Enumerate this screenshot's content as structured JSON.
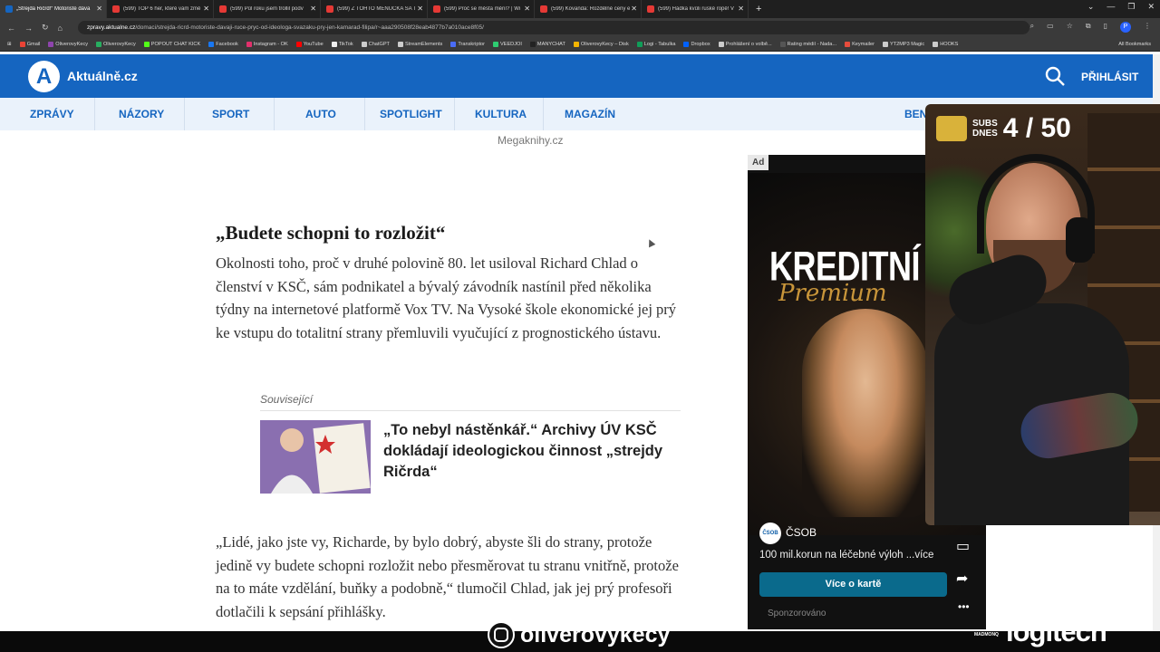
{
  "browser": {
    "tabs": [
      {
        "title": "„Strejda Ričrd!“ Motoristé dáva",
        "color": "#1565c0"
      },
      {
        "title": "(599) TOP 6 her, které vám změ",
        "color": "#e53935"
      },
      {
        "title": "(599) Půl roku jsem trollil podv",
        "color": "#e53935"
      },
      {
        "title": "(599) Z TOHTO MENUČKA SA T",
        "color": "#e53935"
      },
      {
        "title": "(599) Proč se města mění? | Wi",
        "color": "#e53935"
      },
      {
        "title": "(599) Kovanda: Rozdělné ceny e",
        "color": "#e53935"
      },
      {
        "title": "(599) Hádka kvůli ruské ropě! V",
        "color": "#e53935"
      }
    ],
    "new_tab": "+",
    "url_domain": "zpravy.aktualne.cz",
    "url_path": "/domaci/strejda-ricrd-motoriste-davaji-ruce-pryc-od-ideologa-svazaku-pry-jen-kamarad-filipa/r~aaa290508f28eab4877b7a010ace8f05/",
    "profile_initial": "P",
    "bookmarks": [
      {
        "label": "Gmail",
        "color": "#ea4335"
      },
      {
        "label": "OliverovyKecy",
        "color": "#8e44ad"
      },
      {
        "label": "OliverovyKecy",
        "color": "#27ae60"
      },
      {
        "label": "POPOUT CHAT KICK",
        "color": "#53fc18"
      },
      {
        "label": "Facebook",
        "color": "#1877f2"
      },
      {
        "label": "Instagram - OK",
        "color": "#e1306c"
      },
      {
        "label": "YouTube",
        "color": "#ff0000"
      },
      {
        "label": "TikTok",
        "color": "#eeeeee"
      },
      {
        "label": "ChatGPT",
        "color": "#cccccc"
      },
      {
        "label": "StreamElements",
        "color": "#cccccc"
      },
      {
        "label": "Transkriptor",
        "color": "#4a6cf7"
      },
      {
        "label": "VEEDJOI",
        "color": "#2ecc71"
      },
      {
        "label": "MANYCHAT",
        "color": "#222222"
      },
      {
        "label": "OliverovyKecy – Disk",
        "color": "#f4b400"
      },
      {
        "label": "Logi - Tabulka",
        "color": "#0f9d58"
      },
      {
        "label": "Dropbox",
        "color": "#0061ff"
      },
      {
        "label": "Prohlášení o volbě...",
        "color": "#cccccc"
      },
      {
        "label": "Rating médií - Nada...",
        "color": "#555555"
      },
      {
        "label": "Keymailer",
        "color": "#e74c3c"
      },
      {
        "label": "YT2MP3 Magic",
        "color": "#cccccc"
      },
      {
        "label": "HOOKS",
        "color": "#cccccc"
      }
    ],
    "all_bookmarks": "All Bookmarks"
  },
  "site": {
    "logo_letter": "A",
    "logo_text": "Aktuálně.cz",
    "login": "PŘIHLÁSIT",
    "brand_color": "#1565c0",
    "nav": [
      "ZPRÁVY",
      "NÁZORY",
      "SPORT",
      "AUTO",
      "SPOTLIGHT",
      "KULTURA",
      "MAGAZÍN",
      "BEN"
    ]
  },
  "article": {
    "image_credit": "Megaknihy.cz",
    "heading": "„Budete schopni to rozložit“",
    "paragraph1": "Okolnosti toho, proč v druhé polovině 80. let usiloval Richard Chlad o členství v KSČ, sám podnikatel a bývalý závodník nastínil před několika týdny na internetové platformě Vox TV. Na Vysoké škole ekonomické jej prý ke vstupu do totalitní strany přemluvili vyučující z prognostického ústavu.",
    "related_label": "Související",
    "related_title": "„To nebyl nástěnkář.“ Archivy ÚV KSČ dokládají ideologickou činnost „strejdy Ričrda“",
    "paragraph2": "„Lidé, jako jste vy, Richarde, by bylo dobrý, abyste šli do strany, protože jedině vy budete schopni rozložit nebo přesměrovat tu stranu vnitřně, protože na to máte vzdělání, buňky a podobně,“ tlumočil Chlad, jak jej prý profesoři dotlačili k sepsání přihlášky."
  },
  "ad": {
    "label": "Ad",
    "headline": "KREDITNÍ KA",
    "script": "Premium",
    "advertiser": "ČSOB",
    "advertiser_logo": "ČSOB",
    "description": "100 mil.korun na léčebné výloh ...více",
    "cta": "Více o kartě",
    "sponsored": "Sponzorováno"
  },
  "overlay": {
    "subs_label_line1": "SUBS",
    "subs_label_line2": "DNES",
    "subs_count": "4 / 50",
    "instagram_handle": "oliverovykecy",
    "sponsor_small": "MADMONQ",
    "sponsor": "logitech"
  }
}
